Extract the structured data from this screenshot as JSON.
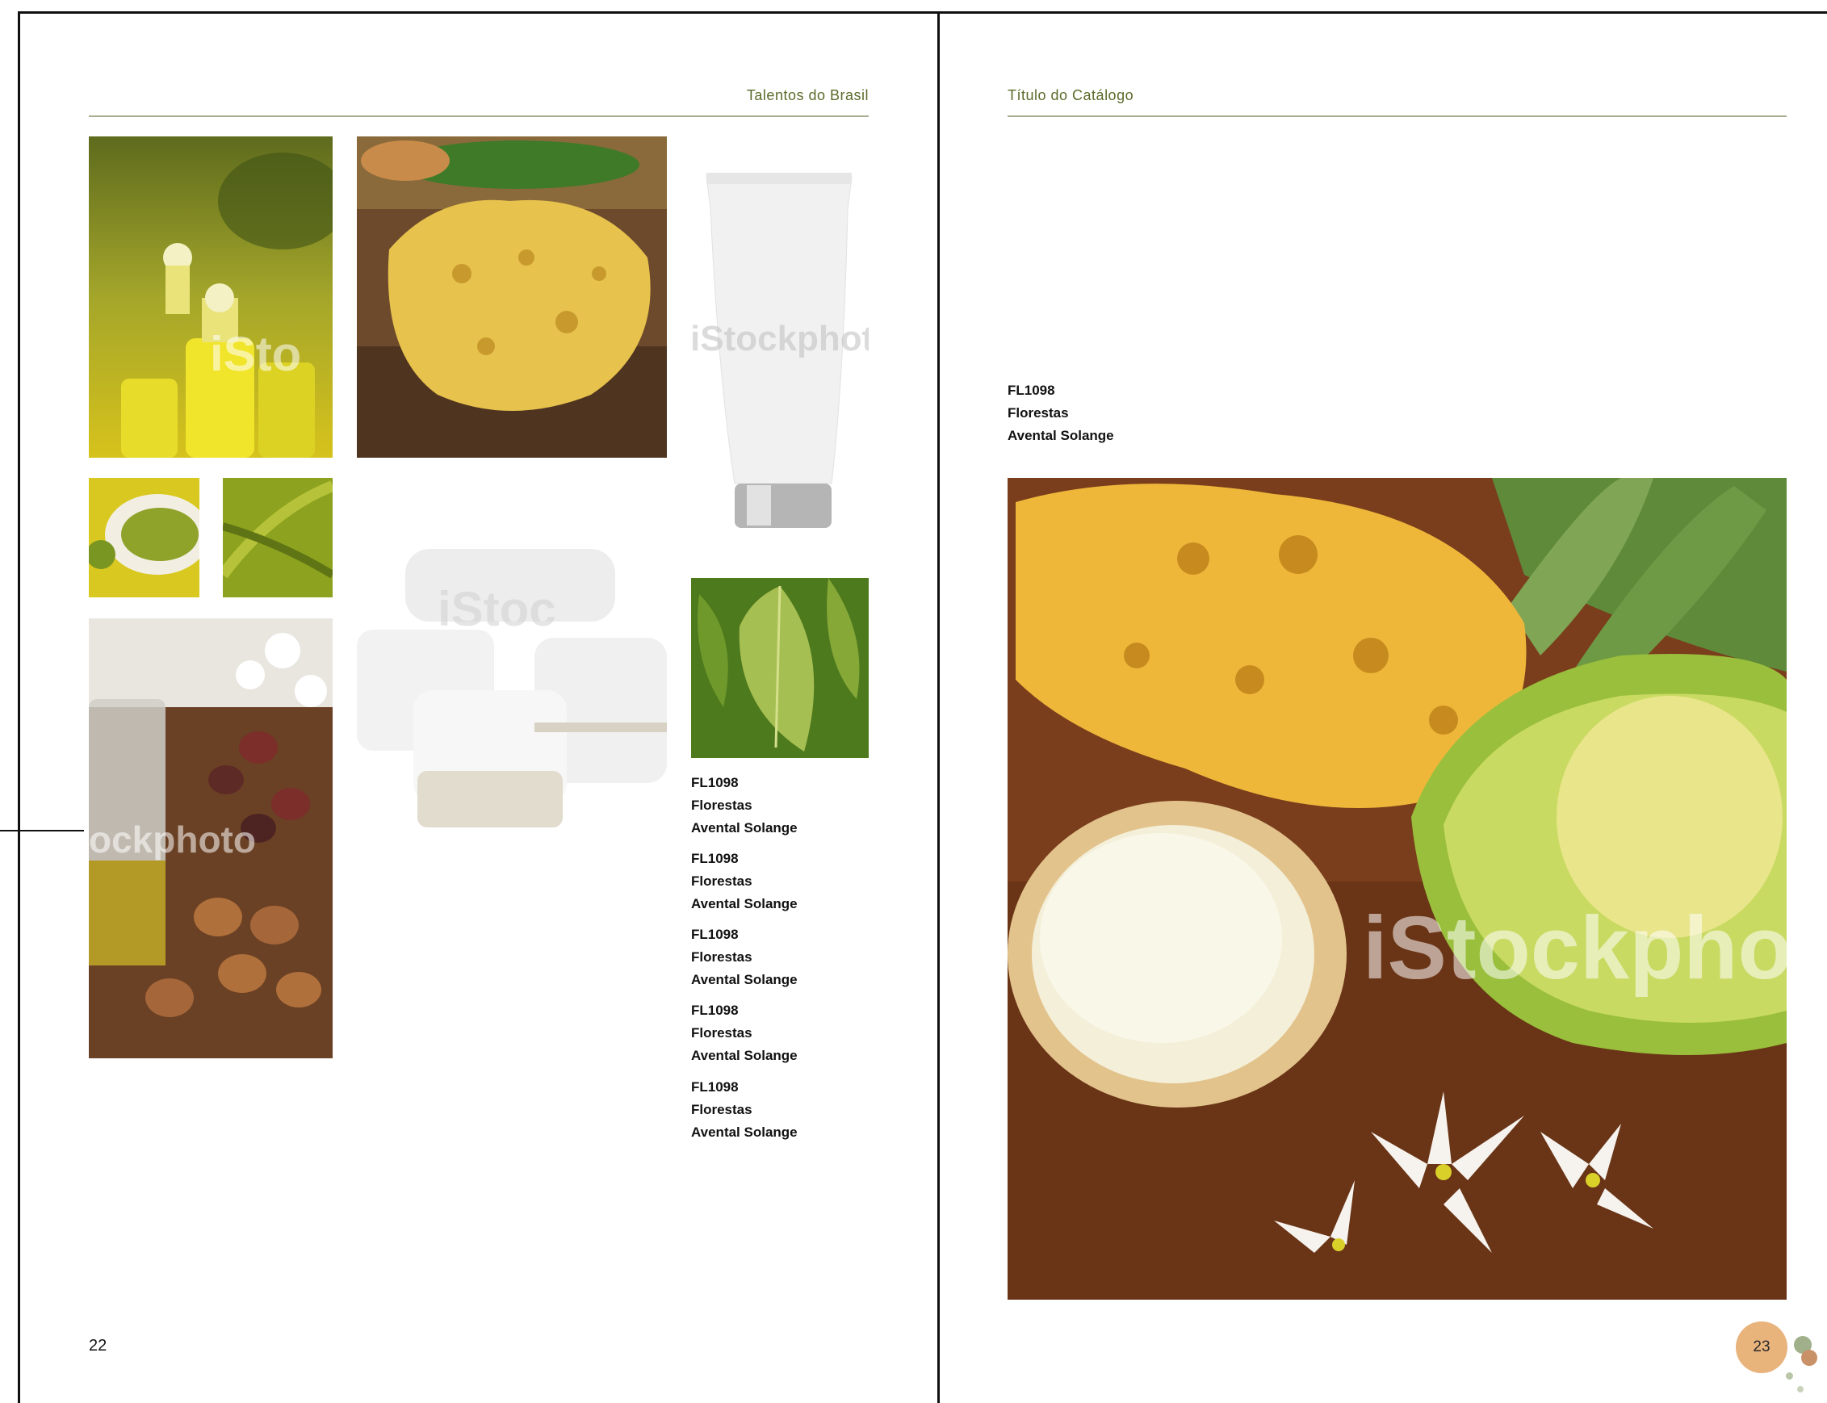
{
  "left_page": {
    "running_head": "Talentos do Brasil",
    "page_number": "22",
    "captions": [
      {
        "code": "FL1098",
        "line": "Florestas",
        "name": "Avental Solange"
      },
      {
        "code": "FL1098",
        "line": "Florestas",
        "name": "Avental Solange"
      },
      {
        "code": "FL1098",
        "line": "Florestas",
        "name": "Avental Solange"
      },
      {
        "code": "FL1098",
        "line": "Florestas",
        "name": "Avental Solange"
      },
      {
        "code": "FL1098",
        "line": "Florestas",
        "name": "Avental Solange"
      }
    ],
    "watermarks": [
      "iSto",
      "iStockphoto",
      "iStoc",
      "ockphoto"
    ]
  },
  "right_page": {
    "running_head": "Título do Catálogo",
    "page_number": "23",
    "caption": {
      "code": "FL1098",
      "line": "Florestas",
      "name": "Avental Solange"
    },
    "watermark": "iStockphot"
  },
  "colors": {
    "accent_green": "#5b6a2a",
    "rule": "#a7ad8f",
    "badge": "#e9b37c"
  }
}
